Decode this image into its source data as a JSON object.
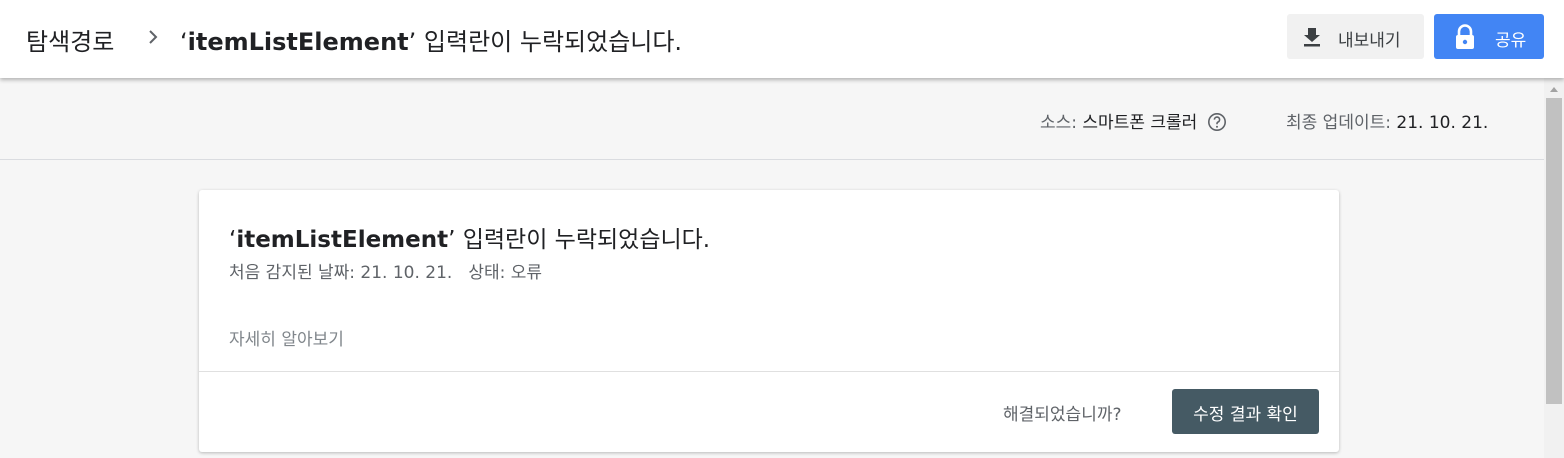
{
  "header": {
    "breadcrumb_root": "탐색경로",
    "title_quote_open": "‘",
    "title_term": "itemListElement",
    "title_quote_close": "’",
    "title_rest": " 입력란이 누락되었습니다.",
    "export_label": "내보내기",
    "share_label": "공유"
  },
  "info": {
    "source_label": "소스:",
    "source_value": "스마트폰 크롤러",
    "updated_label": "최종 업데이트:",
    "updated_value": "21. 10. 21."
  },
  "issue": {
    "title_quote_open": "‘",
    "title_term": "itemListElement",
    "title_quote_close": "’",
    "title_rest": " 입력란이 누락되었습니다.",
    "first_detected": "처음 감지된 날짜: 21. 10. 21.",
    "status": "상태: 오류",
    "learn_more": "자세히 알아보기",
    "resolved_question": "해결되었습니까?",
    "validate_button": "수정 결과 확인"
  },
  "icons": {
    "breadcrumb_separator": "chevron-right-icon",
    "export": "download-icon",
    "share": "lock-icon",
    "help": "help-circle-icon"
  },
  "colors": {
    "share_button": "#4285f4",
    "validate_button": "#455a64",
    "page_background": "#f6f6f6"
  }
}
